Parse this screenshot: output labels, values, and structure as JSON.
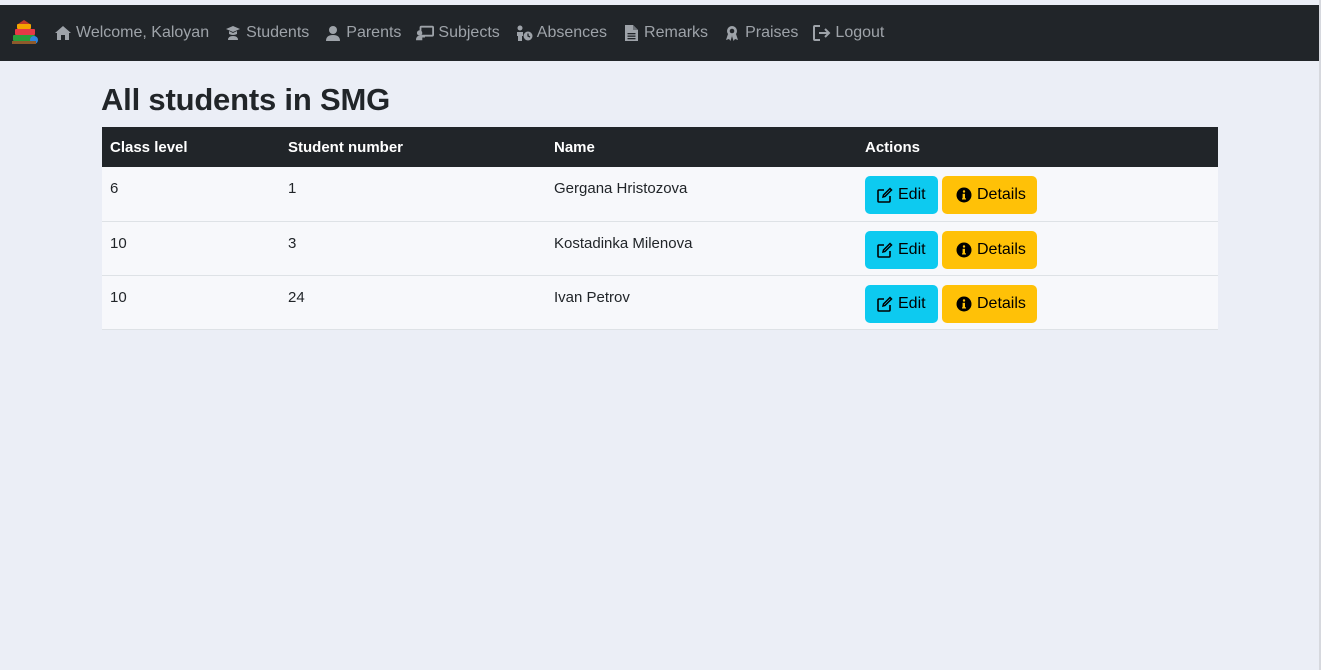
{
  "nav": {
    "welcome": "Welcome, Kaloyan",
    "items": [
      {
        "label": "Students",
        "icon": "graduate-icon"
      },
      {
        "label": "Parents",
        "icon": "user-icon"
      },
      {
        "label": "Subjects",
        "icon": "chalkboard-teacher-icon"
      },
      {
        "label": "Absences",
        "icon": "person-clock-icon"
      },
      {
        "label": "Remarks",
        "icon": "file-text-icon"
      },
      {
        "label": "Praises",
        "icon": "award-icon"
      }
    ],
    "logout": "Logout"
  },
  "page": {
    "title": "All students in SMG"
  },
  "table": {
    "headers": [
      "Class level",
      "Student number",
      "Name",
      "Actions"
    ],
    "rows": [
      {
        "class_level": "6",
        "student_number": "1",
        "name": "Gergana Hristozova"
      },
      {
        "class_level": "10",
        "student_number": "3",
        "name": "Kostadinka Milenova"
      },
      {
        "class_level": "10",
        "student_number": "24",
        "name": "Ivan Petrov"
      }
    ],
    "edit_label": "Edit",
    "details_label": "Details"
  },
  "colors": {
    "navbar": "#212529",
    "edit_button": "#0dcaf0",
    "details_button": "#ffc107",
    "background": "#ebeef6"
  }
}
